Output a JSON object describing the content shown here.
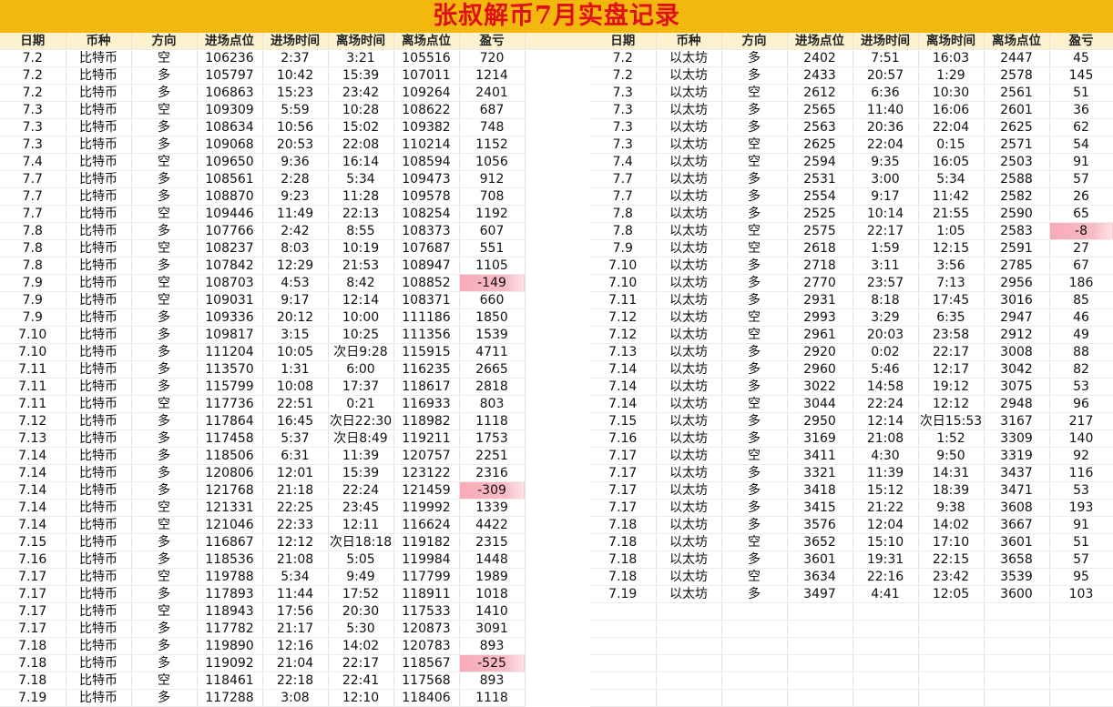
{
  "title": "张叔解币7月实盘记录",
  "headers": [
    "日期",
    "币种",
    "方向",
    "进场点位",
    "进场时间",
    "离场时间",
    "离场点位",
    "盈亏"
  ],
  "btc_records": [
    [
      "7.2",
      "比特币",
      "空",
      "106236",
      "2:37",
      "3:21",
      "105516",
      "720"
    ],
    [
      "7.2",
      "比特币",
      "多",
      "105797",
      "10:42",
      "15:39",
      "107011",
      "1214"
    ],
    [
      "7.2",
      "比特币",
      "多",
      "106863",
      "15:23",
      "23:42",
      "109264",
      "2401"
    ],
    [
      "7.3",
      "比特币",
      "空",
      "109309",
      "5:59",
      "10:28",
      "108622",
      "687"
    ],
    [
      "7.3",
      "比特币",
      "多",
      "108634",
      "10:56",
      "15:02",
      "109382",
      "748"
    ],
    [
      "7.3",
      "比特币",
      "多",
      "109068",
      "20:53",
      "22:08",
      "110214",
      "1152"
    ],
    [
      "7.4",
      "比特币",
      "空",
      "109650",
      "9:36",
      "16:14",
      "108594",
      "1056"
    ],
    [
      "7.7",
      "比特币",
      "多",
      "108561",
      "2:28",
      "5:34",
      "109473",
      "912"
    ],
    [
      "7.7",
      "比特币",
      "多",
      "108870",
      "9:23",
      "11:28",
      "109578",
      "708"
    ],
    [
      "7.7",
      "比特币",
      "空",
      "109446",
      "11:49",
      "22:13",
      "108254",
      "1192"
    ],
    [
      "7.8",
      "比特币",
      "多",
      "107766",
      "2:42",
      "8:55",
      "108373",
      "607"
    ],
    [
      "7.8",
      "比特币",
      "空",
      "108237",
      "8:03",
      "10:19",
      "107687",
      "551"
    ],
    [
      "7.8",
      "比特币",
      "多",
      "107842",
      "12:29",
      "21:53",
      "108947",
      "1105"
    ],
    [
      "7.9",
      "比特币",
      "空",
      "108703",
      "4:53",
      "8:42",
      "108852",
      "-149"
    ],
    [
      "7.9",
      "比特币",
      "空",
      "109031",
      "9:17",
      "12:14",
      "108371",
      "660"
    ],
    [
      "7.9",
      "比特币",
      "多",
      "109336",
      "20:12",
      "10:00",
      "111186",
      "1850"
    ],
    [
      "7.10",
      "比特币",
      "多",
      "109817",
      "3:15",
      "10:25",
      "111356",
      "1539"
    ],
    [
      "7.10",
      "比特币",
      "多",
      "111204",
      "10:05",
      "次日9:28",
      "115915",
      "4711"
    ],
    [
      "7.11",
      "比特币",
      "多",
      "113570",
      "1:31",
      "6:00",
      "116235",
      "2665"
    ],
    [
      "7.11",
      "比特币",
      "多",
      "115799",
      "10:08",
      "17:37",
      "118617",
      "2818"
    ],
    [
      "7.11",
      "比特币",
      "空",
      "117736",
      "22:51",
      "0:21",
      "116933",
      "803"
    ],
    [
      "7.12",
      "比特币",
      "多",
      "117864",
      "16:45",
      "次日22:30",
      "118982",
      "1118"
    ],
    [
      "7.13",
      "比特币",
      "多",
      "117458",
      "5:37",
      "次日8:49",
      "119211",
      "1753"
    ],
    [
      "7.14",
      "比特币",
      "多",
      "118506",
      "6:31",
      "11:39",
      "120757",
      "2251"
    ],
    [
      "7.14",
      "比特币",
      "多",
      "120806",
      "12:01",
      "15:39",
      "123122",
      "2316"
    ],
    [
      "7.14",
      "比特币",
      "多",
      "121768",
      "21:18",
      "22:24",
      "121459",
      "-309"
    ],
    [
      "7.14",
      "比特币",
      "空",
      "121331",
      "22:25",
      "23:45",
      "119992",
      "1339"
    ],
    [
      "7.14",
      "比特币",
      "空",
      "121046",
      "22:33",
      "12:11",
      "116624",
      "4422"
    ],
    [
      "7.15",
      "比特币",
      "多",
      "116867",
      "12:12",
      "次日18:18",
      "119182",
      "2315"
    ],
    [
      "7.16",
      "比特币",
      "多",
      "118536",
      "21:08",
      "5:05",
      "119984",
      "1448"
    ],
    [
      "7.17",
      "比特币",
      "空",
      "119788",
      "5:34",
      "9:49",
      "117799",
      "1989"
    ],
    [
      "7.17",
      "比特币",
      "多",
      "117893",
      "11:44",
      "17:52",
      "118911",
      "1018"
    ],
    [
      "7.17",
      "比特币",
      "空",
      "118943",
      "17:56",
      "20:30",
      "117533",
      "1410"
    ],
    [
      "7.17",
      "比特币",
      "多",
      "117782",
      "21:17",
      "5:30",
      "120873",
      "3091"
    ],
    [
      "7.18",
      "比特币",
      "多",
      "119890",
      "12:16",
      "14:02",
      "120783",
      "893"
    ],
    [
      "7.18",
      "比特币",
      "多",
      "119092",
      "21:04",
      "22:17",
      "118567",
      "-525"
    ],
    [
      "7.18",
      "比特币",
      "空",
      "118461",
      "22:18",
      "22:41",
      "117568",
      "893"
    ],
    [
      "7.19",
      "比特币",
      "多",
      "117288",
      "3:08",
      "12:10",
      "118406",
      "1118"
    ]
  ],
  "eth_records": [
    [
      "7.2",
      "以太坊",
      "多",
      "2402",
      "7:51",
      "16:03",
      "2447",
      "45"
    ],
    [
      "7.2",
      "以太坊",
      "多",
      "2433",
      "20:57",
      "1:29",
      "2578",
      "145"
    ],
    [
      "7.3",
      "以太坊",
      "空",
      "2612",
      "6:36",
      "10:30",
      "2561",
      "51"
    ],
    [
      "7.3",
      "以太坊",
      "多",
      "2565",
      "11:40",
      "16:06",
      "2601",
      "36"
    ],
    [
      "7.3",
      "以太坊",
      "多",
      "2563",
      "20:36",
      "22:04",
      "2625",
      "62"
    ],
    [
      "7.3",
      "以太坊",
      "空",
      "2625",
      "22:04",
      "0:15",
      "2571",
      "54"
    ],
    [
      "7.4",
      "以太坊",
      "空",
      "2594",
      "9:35",
      "16:05",
      "2503",
      "91"
    ],
    [
      "7.7",
      "以太坊",
      "多",
      "2531",
      "3:00",
      "5:34",
      "2588",
      "57"
    ],
    [
      "7.7",
      "以太坊",
      "多",
      "2554",
      "9:17",
      "11:42",
      "2582",
      "26"
    ],
    [
      "7.8",
      "以太坊",
      "多",
      "2525",
      "10:14",
      "21:55",
      "2590",
      "65"
    ],
    [
      "7.8",
      "以太坊",
      "空",
      "2575",
      "22:17",
      "1:05",
      "2583",
      "-8"
    ],
    [
      "7.9",
      "以太坊",
      "空",
      "2618",
      "1:59",
      "12:15",
      "2591",
      "27"
    ],
    [
      "7.10",
      "以太坊",
      "多",
      "2718",
      "3:11",
      "3:56",
      "2785",
      "67"
    ],
    [
      "7.10",
      "以太坊",
      "多",
      "2770",
      "23:57",
      "7:13",
      "2956",
      "186"
    ],
    [
      "7.11",
      "以太坊",
      "多",
      "2931",
      "8:18",
      "17:45",
      "3016",
      "85"
    ],
    [
      "7.12",
      "以太坊",
      "空",
      "2993",
      "3:29",
      "6:35",
      "2947",
      "46"
    ],
    [
      "7.12",
      "以太坊",
      "空",
      "2961",
      "20:03",
      "23:58",
      "2912",
      "49"
    ],
    [
      "7.13",
      "以太坊",
      "多",
      "2920",
      "0:02",
      "22:17",
      "3008",
      "88"
    ],
    [
      "7.14",
      "以太坊",
      "多",
      "2960",
      "5:46",
      "12:17",
      "3042",
      "82"
    ],
    [
      "7.14",
      "以太坊",
      "多",
      "3022",
      "14:58",
      "19:12",
      "3075",
      "53"
    ],
    [
      "7.14",
      "以太坊",
      "空",
      "3044",
      "22:24",
      "12:12",
      "2948",
      "96"
    ],
    [
      "7.15",
      "以太坊",
      "多",
      "2950",
      "12:14",
      "次日15:53",
      "3167",
      "217"
    ],
    [
      "7.16",
      "以太坊",
      "多",
      "3169",
      "21:08",
      "1:52",
      "3309",
      "140"
    ],
    [
      "7.17",
      "以太坊",
      "空",
      "3411",
      "4:30",
      "9:50",
      "3319",
      "92"
    ],
    [
      "7.17",
      "以太坊",
      "多",
      "3321",
      "11:39",
      "14:31",
      "3437",
      "116"
    ],
    [
      "7.17",
      "以太坊",
      "多",
      "3418",
      "15:12",
      "18:39",
      "3471",
      "53"
    ],
    [
      "7.17",
      "以太坊",
      "多",
      "3415",
      "21:22",
      "9:38",
      "3608",
      "193"
    ],
    [
      "7.18",
      "以太坊",
      "多",
      "3576",
      "12:04",
      "14:02",
      "3667",
      "91"
    ],
    [
      "7.18",
      "以太坊",
      "空",
      "3652",
      "15:10",
      "17:10",
      "3601",
      "51"
    ],
    [
      "7.18",
      "以太坊",
      "多",
      "3601",
      "19:31",
      "22:15",
      "3658",
      "57"
    ],
    [
      "7.18",
      "以太坊",
      "空",
      "3634",
      "22:16",
      "23:42",
      "3539",
      "95"
    ],
    [
      "7.19",
      "以太坊",
      "多",
      "3497",
      "4:41",
      "12:05",
      "3600",
      "103"
    ]
  ],
  "colors": {
    "title_bar": "#f3b80d",
    "title_text": "#e0101a",
    "long_direction": "#1a8b3a",
    "short_direction": "#e0101a",
    "profit_text": "#e0101a",
    "loss_highlight": "#f7aab6"
  }
}
